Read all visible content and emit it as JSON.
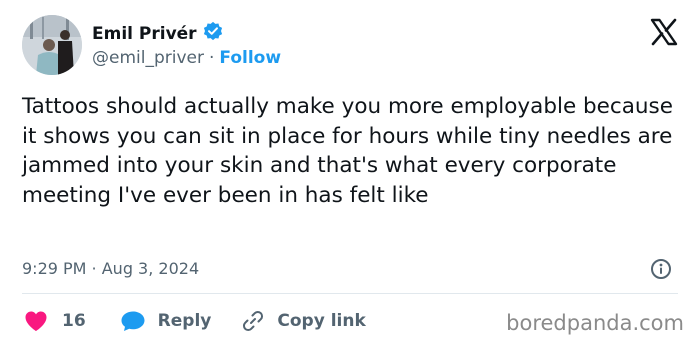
{
  "author": {
    "name": "Emil Privér",
    "handle": "@emil_priver",
    "separator": "·",
    "follow_label": "Follow",
    "verified": true
  },
  "tweet": {
    "text": "Tattoos should actually make you more employable because it shows you can sit in place for hours while tiny needles are jammed into your skin and that's what every corporate meeting I've ever been in has felt like",
    "timestamp": "9:29 PM · Aug 3, 2024"
  },
  "actions": {
    "like_count": "16",
    "reply_label": "Reply",
    "copy_link_label": "Copy link"
  },
  "watermark": "boredpanda.com",
  "icons": [
    "x-logo-icon",
    "verified-badge-icon",
    "info-icon",
    "heart-icon",
    "reply-bubble-icon",
    "link-icon"
  ],
  "colors": {
    "accent": "#1d9bf0",
    "like": "#f91880",
    "text": "#0f1419",
    "secondary": "#536471"
  }
}
